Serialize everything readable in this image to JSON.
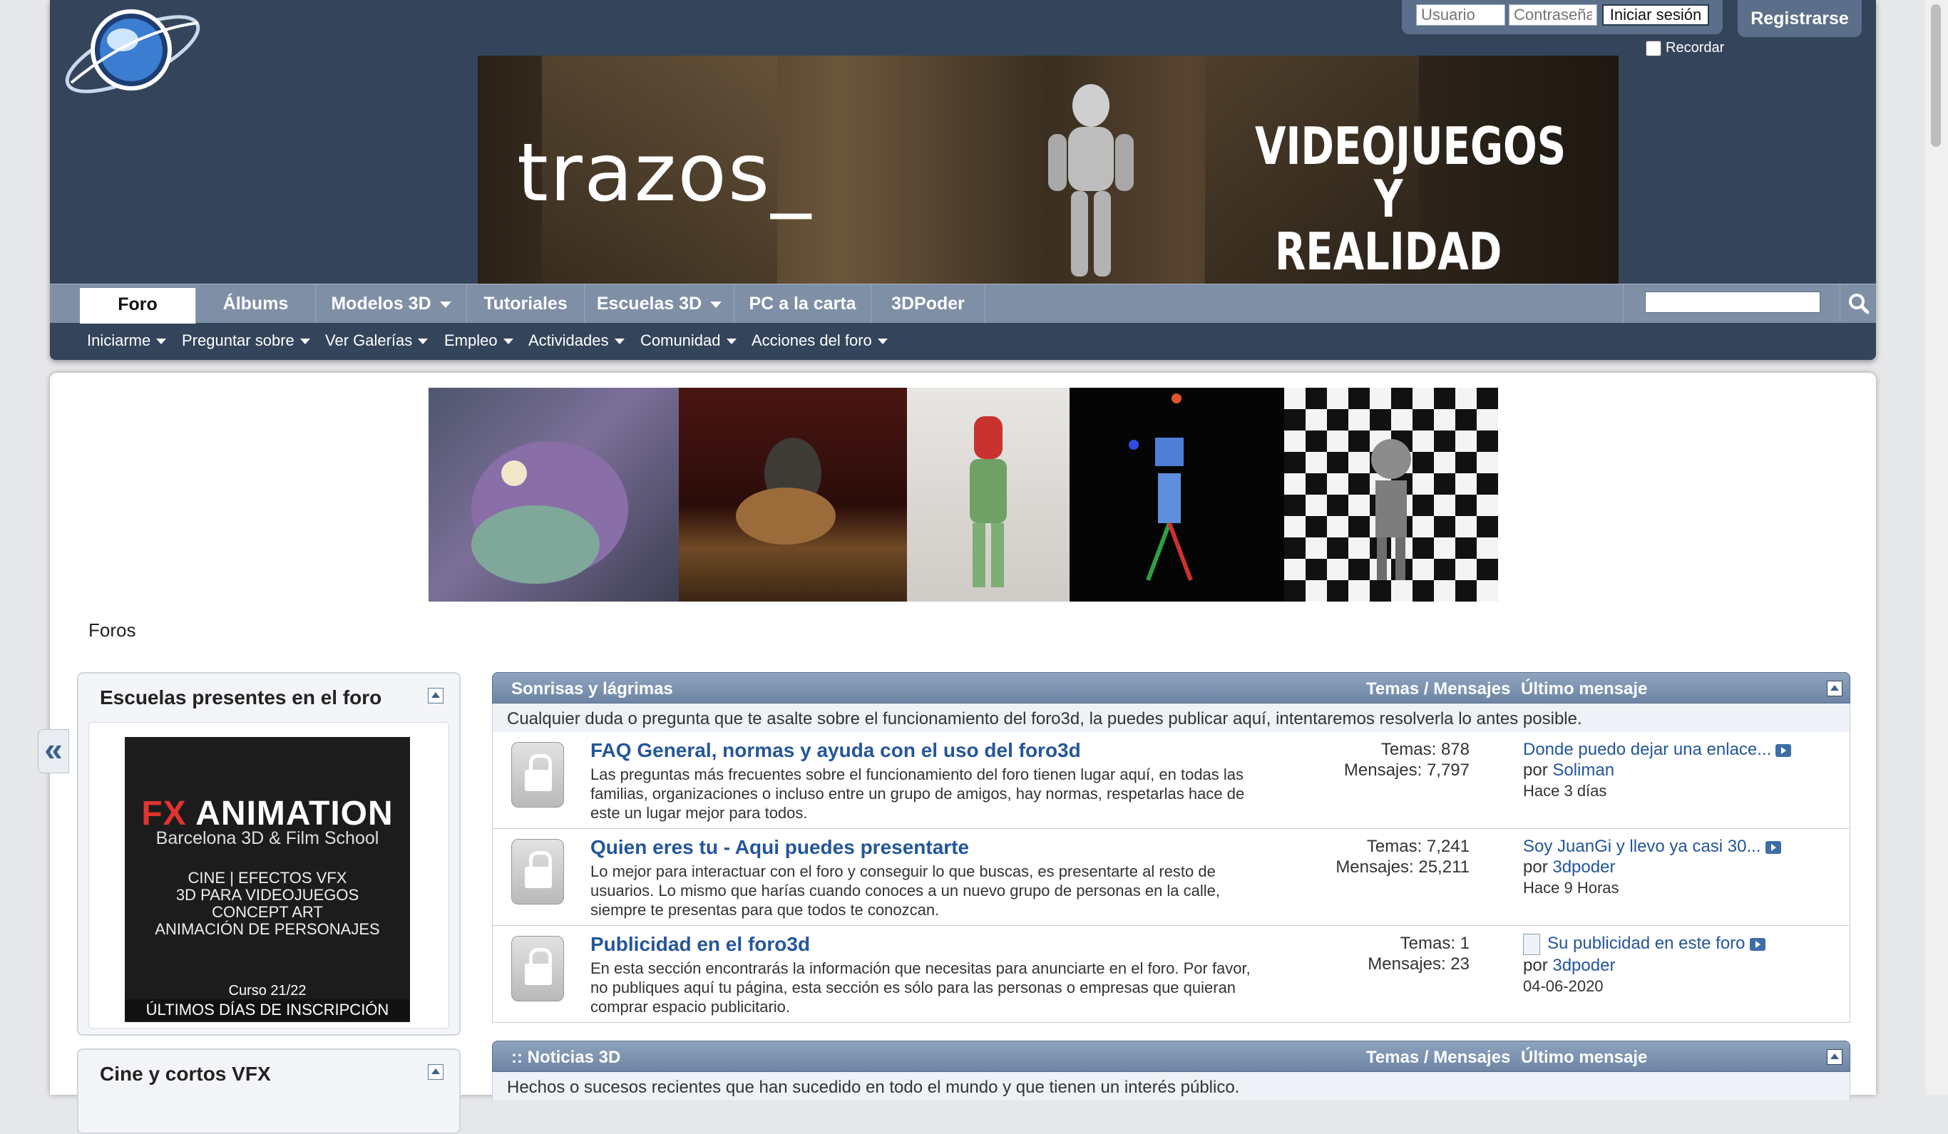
{
  "login": {
    "username_placeholder": "Usuario",
    "password_placeholder": "Contraseña",
    "submit_label": "Iniciar sesión",
    "remember_label": "Recordar",
    "register_label": "Registrarse"
  },
  "banner": {
    "brand": "trazos_",
    "tagline_line1": "VIDEOJUEGOS Y",
    "tagline_line2": "REALIDAD VIRTUAL"
  },
  "nav": {
    "tabs": [
      {
        "label": "Foro",
        "active": true
      },
      {
        "label": "Álbums"
      },
      {
        "label": "Modelos 3D",
        "dropdown": true
      },
      {
        "label": "Tutoriales"
      },
      {
        "label": "Escuelas 3D",
        "dropdown": true
      },
      {
        "label": "PC a la carta"
      },
      {
        "label": "3DPoder"
      }
    ],
    "search_value": ""
  },
  "subnav": {
    "items": [
      {
        "label": "Iniciarme"
      },
      {
        "label": "Preguntar sobre"
      },
      {
        "label": "Ver Galerías"
      },
      {
        "label": "Empleo"
      },
      {
        "label": "Actividades"
      },
      {
        "label": "Comunidad"
      },
      {
        "label": "Acciones del foro"
      }
    ]
  },
  "breadcrumb": "Foros",
  "sidebar": {
    "block1_title": "Escuelas presentes en el foro",
    "block2_title": "Cine y cortos VFX",
    "ad": {
      "brand_fx": "FX",
      "brand_rest": "ANIMATION",
      "subtitle": "Barcelona 3D & Film School",
      "line1": "CINE | EFECTOS VFX",
      "line2": "3D PARA VIDEOJUEGOS",
      "line3": "CONCEPT ART",
      "line4": "ANIMACIÓN DE PERSONAJES",
      "course": "Curso 21/22",
      "deadline": "ÚLTIMOS DÍAS DE INSCRIPCIÓN"
    }
  },
  "forum": {
    "columns": {
      "topics_posts": "Temas / Mensajes",
      "last_post": "Último mensaje"
    },
    "categories": [
      {
        "title": "Sonrisas y lágrimas",
        "description": "Cualquier duda o pregunta que te asalte sobre el funcionamiento del foro3d, la puedes publicar aquí, intentaremos resolverla lo antes posible.",
        "forums": [
          {
            "title": "FAQ General, normas y ayuda con el uso del foro3d",
            "description": "Las preguntas más frecuentes sobre el funcionamiento del foro tienen lugar aquí, en todas las familias, organizaciones o incluso entre un grupo de amigos, hay normas, respetarlas hace de este un lugar mejor para todos.",
            "topics": "Temas: 878",
            "posts": "Mensajes: 7,797",
            "last_title": "Donde puedo dejar una enlace...",
            "last_by_prefix": "por",
            "last_user": "Soliman",
            "last_when": "Hace 3 días"
          },
          {
            "title": "Quien eres tu - Aqui puedes presentarte",
            "description": "Lo mejor para interactuar con el foro y conseguir lo que buscas, es presentarte al resto de usuarios. Lo mismo que harías cuando conoces a un nuevo grupo de personas en la calle, siempre te presentas para que todos te conozcan.",
            "topics": "Temas: 7,241",
            "posts": "Mensajes: 25,211",
            "last_title": "Soy JuanGi y llevo ya casi 30...",
            "last_by_prefix": "por",
            "last_user": "3dpoder",
            "last_when": "Hace 9 Horas"
          },
          {
            "title": "Publicidad en el foro3d",
            "description": "En esta sección encontrarás la información que necesitas para anunciarte en el foro. Por favor, no publiques aquí tu página, esta sección es sólo para las personas o empresas que quieran comprar espacio publicitario.",
            "topics": "Temas: 1",
            "posts": "Mensajes: 23",
            "last_title": "Su publicidad en este foro",
            "last_by_prefix": "por",
            "last_user": "3dpoder",
            "last_when": "04-06-2020"
          }
        ]
      },
      {
        "title": ":: Noticias 3D",
        "description": "Hechos o sucesos recientes que han sucedido en todo el mundo y que tienen un interés público."
      }
    ]
  }
}
